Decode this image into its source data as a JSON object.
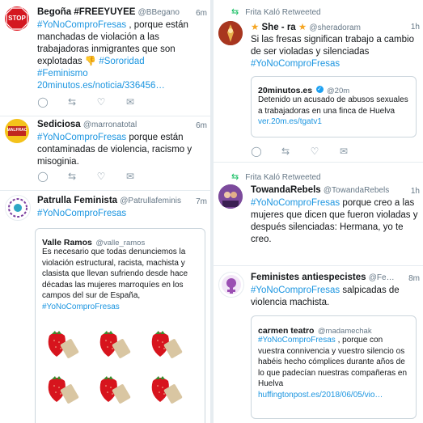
{
  "left": {
    "t1": {
      "name": "Begoña #FREEYUYEE",
      "handle": "@BBegano",
      "time": "6m",
      "avatar_text": "STOP",
      "text_1": "#YoNoComproFresas",
      "text_2": " , porque están manchadas de violación a las trabajadoras inmigrantes que son explotadas ",
      "text_3": "#Sororidad",
      "text_4": "#Feminismo 20minutos.es/noticia/336456…"
    },
    "t2": {
      "name": "Sediciosa",
      "handle": "@marronatotal",
      "time": "6m",
      "avatar_text": "MALFRAC",
      "text_1": "#YoNoComproFresas",
      "text_2": " porque están contaminadas de violencia, racismo y misoginia."
    },
    "t3": {
      "name": "Patrulla Feminista",
      "handle": "@Patrullafeminis",
      "time": "7m",
      "text_1": "#YoNoComproFresas",
      "card_name": "Valle Ramos",
      "card_handle": "@valle_ramos",
      "card_text": "Es necesario que todas denunciemos la violación estructural, racista, machista y clasista que llevan sufriendo desde hace décadas las mujeres marroquíes en los campos del sur de España, ",
      "card_tag": "#YoNoComproFresas"
    }
  },
  "right": {
    "rt1": {
      "rt_label": "Frita Kaló Retweeted",
      "name": "She - ra",
      "handle": "@sheradoram",
      "time": "1h",
      "text_1": "Si las fresas significan trabajo a cambio de ser violadas y silenciadas ",
      "text_2": "#YoNoComproFresas",
      "card_name": "20minutos.es",
      "card_handle": "@20m",
      "card_text": "Detenido un acusado de abusos sexuales a trabajadoras en una finca de Huelva ",
      "card_link": "ver.20m.es/tgatv1"
    },
    "rt2": {
      "rt_label": "Frita Kaló Retweeted",
      "name": "TowandaRebels",
      "handle": "@TowandaRebels",
      "time": "1h",
      "text_1": "#YoNoComproFresas",
      "text_2": " porque creo a las mujeres que dicen que fueron violadas y después silenciadas: Hermana, yo te creo."
    },
    "t3": {
      "name": "Feministes antiespecistes",
      "handle": "@Fe…",
      "time": "8m",
      "text_1": "#YoNoComproFresas",
      "text_2": " salpicadas de violencia machista.",
      "card_name": "carmen teatro",
      "card_handle": "@madamechak",
      "card_tag": "#YoNoComproFresas",
      "card_text": " , porque con vuestra connivencia y vuestro silencio os habéis hecho cómplices durante años de lo que padecían nuestras compañeras en Huelva",
      "card_link": "huffingtonpost.es/2018/06/05/vio…"
    }
  },
  "icons": {
    "reply": "reply-icon",
    "retweet": "retweet-icon",
    "like": "heart-icon",
    "mail": "envelope-icon"
  }
}
